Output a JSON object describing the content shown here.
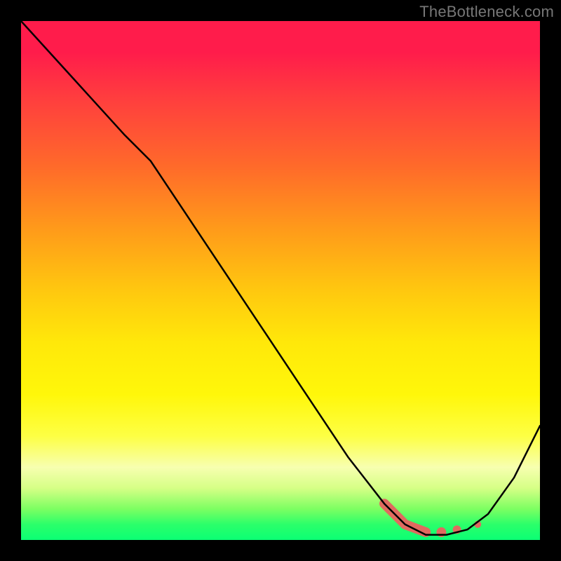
{
  "watermark": "TheBottleneck.com",
  "chart_data": {
    "type": "line",
    "title": "",
    "xlabel": "",
    "ylabel": "",
    "xlim": [
      0,
      100
    ],
    "ylim": [
      0,
      100
    ],
    "grid": false,
    "series": [
      {
        "name": "curve",
        "color": "#000000",
        "x": [
          0,
          10,
          20,
          25,
          35,
          45,
          55,
          63,
          70,
          74,
          78,
          82,
          86,
          90,
          95,
          100
        ],
        "y": [
          100,
          89,
          78,
          73,
          58,
          43,
          28,
          16,
          7,
          3,
          1,
          1,
          2,
          5,
          12,
          22
        ]
      }
    ],
    "highlight": {
      "color": "#e06a5f",
      "segments": [
        {
          "x": [
            70,
            74,
            78
          ],
          "y": [
            7,
            3,
            1.5
          ]
        }
      ],
      "dots": [
        {
          "x": 81,
          "y": 1.5,
          "r": 7
        },
        {
          "x": 84,
          "y": 2,
          "r": 6
        },
        {
          "x": 88,
          "y": 3,
          "r": 5
        }
      ]
    },
    "background_gradient": {
      "top": "#ff1c4b",
      "upper_mid": "#ff9a1a",
      "mid": "#ffe80a",
      "lower_mid": "#f7ffb0",
      "bottom": "#0bff74"
    }
  }
}
